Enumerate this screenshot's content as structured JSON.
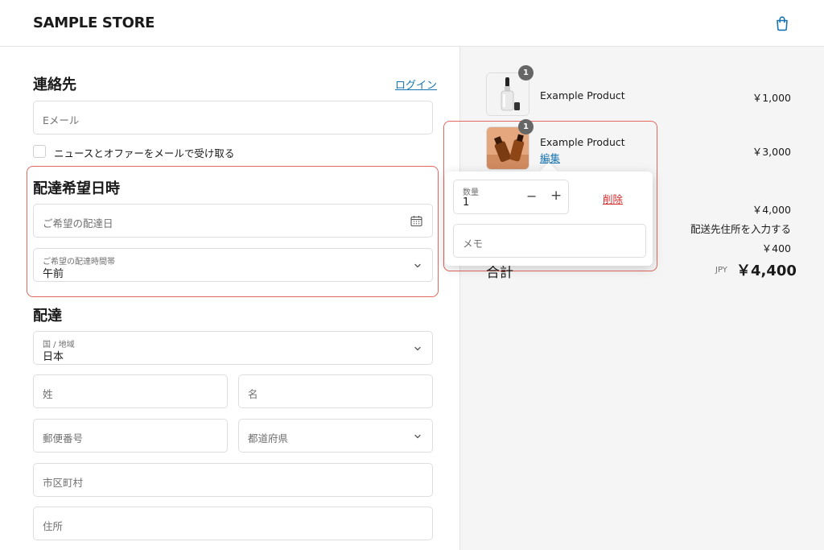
{
  "header": {
    "brand": "SAMPLE STORE",
    "cart_icon": "shopping-bag-icon"
  },
  "contact": {
    "title": "連絡先",
    "login_link": "ログイン",
    "email_placeholder": "Eメール",
    "newsletter_label": "ニュースとオファーをメールで受け取る",
    "newsletter_checked": false
  },
  "delivery_date": {
    "title": "配達希望日時",
    "date_placeholder": "ご希望の配達日",
    "date_icon": "calendar-icon",
    "time_label": "ご希望の配達時間帯",
    "time_value": "午前"
  },
  "shipping": {
    "title": "配達",
    "country_label": "国 / 地域",
    "country_value": "日本",
    "last_name_placeholder": "姓",
    "first_name_placeholder": "名",
    "postal_placeholder": "郵便番号",
    "prefecture_placeholder": "都道府県",
    "city_placeholder": "市区町村",
    "address_placeholder": "住所"
  },
  "cart": {
    "items": [
      {
        "name": "Example Product",
        "price": "￥1,000",
        "quantity_badge": "1"
      },
      {
        "name": "Example Product",
        "price": "￥3,000",
        "quantity_badge": "1",
        "edit_link": "編集"
      }
    ],
    "editor": {
      "quantity_label": "数量",
      "quantity_value": "1",
      "minus": "−",
      "plus": "+",
      "delete_link": "削除",
      "memo_placeholder": "メモ"
    },
    "subtotal_value": "￥4,000",
    "shipping_note": "配送先住所を入力する",
    "shipping_value": "￥400",
    "total_label": "合計",
    "currency": "JPY",
    "total_value": "￥4,400"
  },
  "colors": {
    "link": "#1773b0",
    "delete": "#d42a2a",
    "highlight": "#e2675f"
  }
}
